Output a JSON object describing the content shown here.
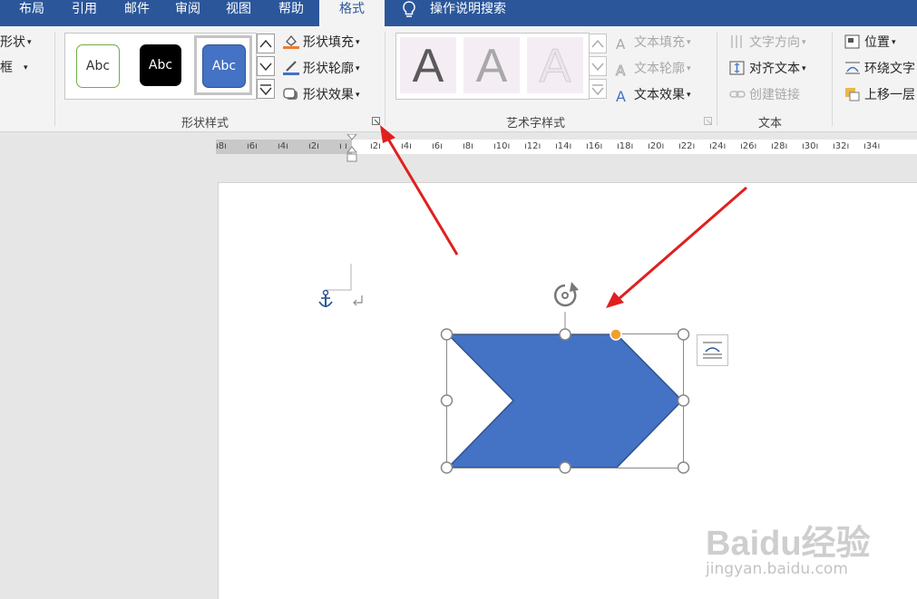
{
  "tabs": [
    {
      "label": "布局",
      "active": false
    },
    {
      "label": "引用",
      "active": false
    },
    {
      "label": "邮件",
      "active": false
    },
    {
      "label": "审阅",
      "active": false
    },
    {
      "label": "视图",
      "active": false
    },
    {
      "label": "帮助",
      "active": false
    },
    {
      "label": "格式",
      "active": true
    }
  ],
  "tell_me": "操作说明搜索",
  "insert_shapes": {
    "shape_label": "形状",
    "textbox_label": "框"
  },
  "shape_styles": {
    "gallery": [
      "Abc",
      "Abc",
      "Abc"
    ],
    "fill": "形状填充",
    "outline": "形状轮廓",
    "effects": "形状效果",
    "group_label": "形状样式"
  },
  "wordart_styles": {
    "samples": [
      "A",
      "A",
      "A"
    ],
    "text_fill": "文本填充",
    "text_outline": "文本轮廓",
    "text_effects": "文本效果",
    "group_label": "艺术字样式"
  },
  "text_group": {
    "direction": "文字方向",
    "align": "对齐文本",
    "link": "创建链接",
    "group_label": "文本"
  },
  "arrange": {
    "position": "位置",
    "wrap": "环绕文字",
    "forward": "上移一层"
  },
  "ruler": {
    "labels": [
      "8",
      "6",
      "4",
      "2",
      "",
      "2",
      "4",
      "6",
      "8",
      "10",
      "12",
      "14",
      "16",
      "18",
      "20",
      "22",
      "24",
      "26",
      "28",
      "30",
      "32",
      "34"
    ]
  },
  "colors": {
    "title_bar": "#2b579a",
    "shape_fill": "#4472c4",
    "shape_border": "#2f528f",
    "annotation_arrow": "#e0201f",
    "adjust_handle": "#f0a030"
  },
  "watermark": {
    "logo": "Baidu经验",
    "url": "jingyan.baidu.com"
  }
}
